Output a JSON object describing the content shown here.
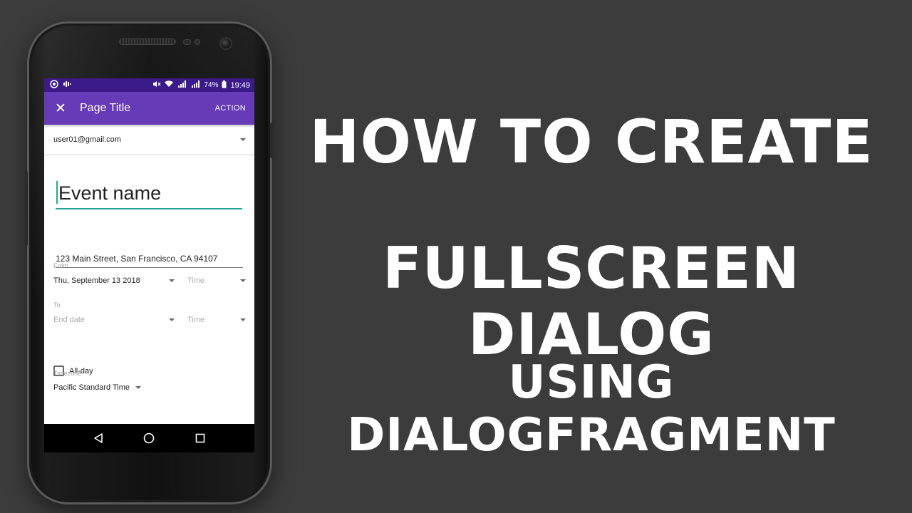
{
  "statusbar": {
    "battery": "74%",
    "time": "19:49"
  },
  "toolbar": {
    "close_icon": "close-icon",
    "title": "Page Title",
    "action_label": "ACTION"
  },
  "account": {
    "email": "user01@gmail.com"
  },
  "form": {
    "event_name": "Event name",
    "address": "123 Main Street, San Francisco, CA 94107",
    "from_label": "From",
    "from_date": "Thu, September 13 2018",
    "from_time": "Time",
    "to_label": "To",
    "to_date": "End date",
    "to_time": "Time",
    "allday_label": "All-day",
    "allday_checked": false,
    "timezone_label": "Timezone",
    "timezone_value": "Pacific Standard Time"
  },
  "headline": {
    "line1": "HOW TO CREATE",
    "line2": "FULLSCREEN DIALOG",
    "line3": "USING DIALOGFRAGMENT"
  },
  "colors": {
    "background": "#3c3c3c",
    "statusbar": "#3b1a8a",
    "toolbar": "#673ab7",
    "accent": "#26a69a",
    "headline_text": "#ffffff"
  }
}
